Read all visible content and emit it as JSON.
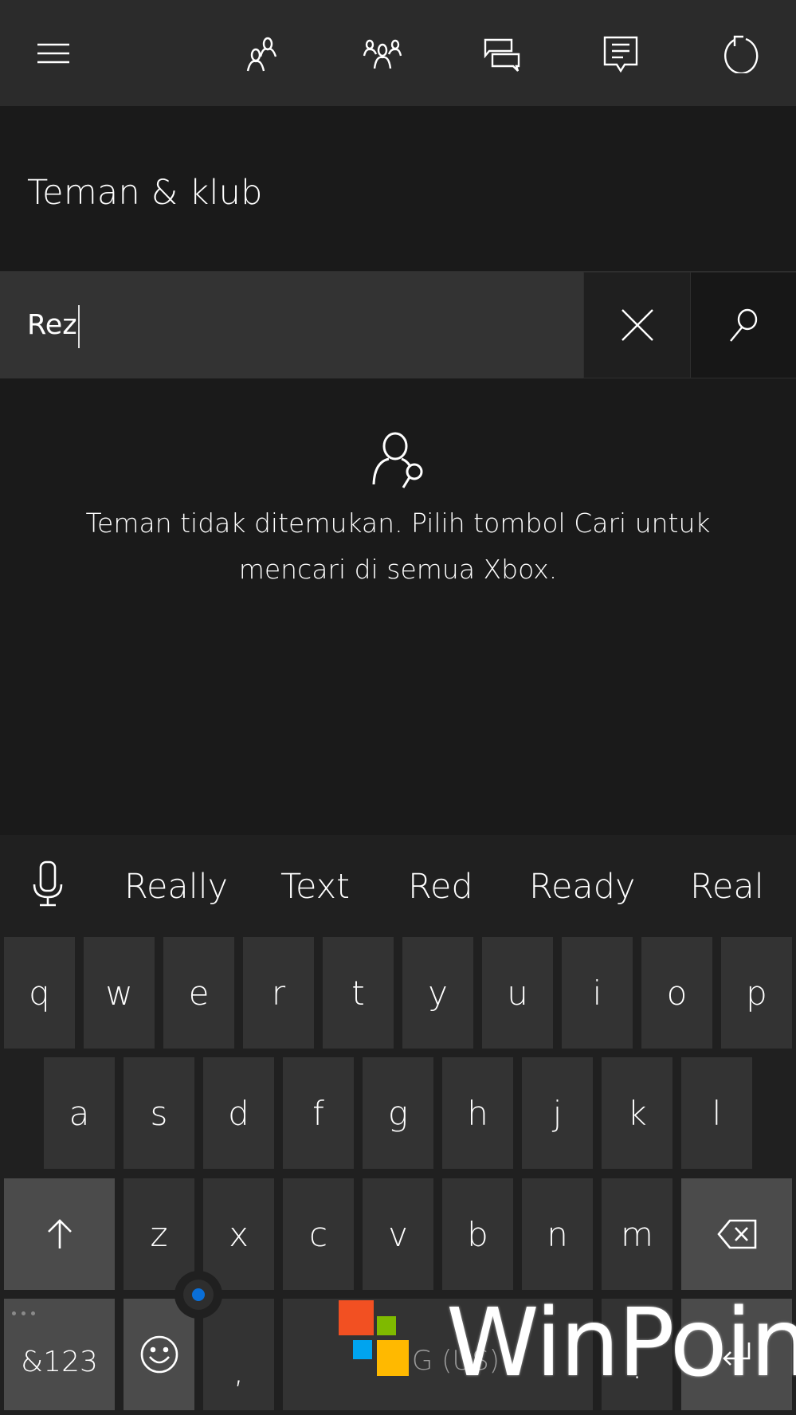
{
  "topbar": {
    "buttons": [
      {
        "name": "menu",
        "icon": "hamburger-icon"
      },
      {
        "name": "friends",
        "icon": "friends-icon"
      },
      {
        "name": "clubs",
        "icon": "clubs-icon"
      },
      {
        "name": "messages",
        "icon": "messages-icon"
      },
      {
        "name": "activity-feed",
        "icon": "feed-icon"
      },
      {
        "name": "refresh",
        "icon": "refresh-icon"
      }
    ]
  },
  "page": {
    "title": "Teman & klub"
  },
  "search": {
    "value": "Rez",
    "placeholder": "",
    "clear_icon": "close-icon",
    "search_icon": "search-icon"
  },
  "empty_state": {
    "icon": "person-search-icon",
    "message": "Teman tidak ditemukan. Pilih tombol Cari untuk mencari di semua Xbox."
  },
  "keyboard": {
    "mic_icon": "microphone-icon",
    "suggestions": [
      "Really",
      "Text",
      "Red",
      "Ready",
      "Real"
    ],
    "row1": [
      "q",
      "w",
      "e",
      "r",
      "t",
      "y",
      "u",
      "i",
      "o",
      "p"
    ],
    "row2": [
      "a",
      "s",
      "d",
      "f",
      "g",
      "h",
      "j",
      "k",
      "l"
    ],
    "row3": [
      "z",
      "x",
      "c",
      "v",
      "b",
      "n",
      "m"
    ],
    "shift_icon": "shift-arrow-icon",
    "backspace_icon": "backspace-icon",
    "symbols_label": "&123",
    "emoji_icon": "emoji-icon",
    "comma_label": ",",
    "space_label": "ENG (US)",
    "period_label": ".",
    "enter_icon": "enter-icon",
    "accent_color": "#0a6fd8"
  },
  "watermark": {
    "text": "WinPoin",
    "logo_colors": [
      "#f25022",
      "#7fba00",
      "#00a4ef",
      "#ffb900"
    ]
  }
}
